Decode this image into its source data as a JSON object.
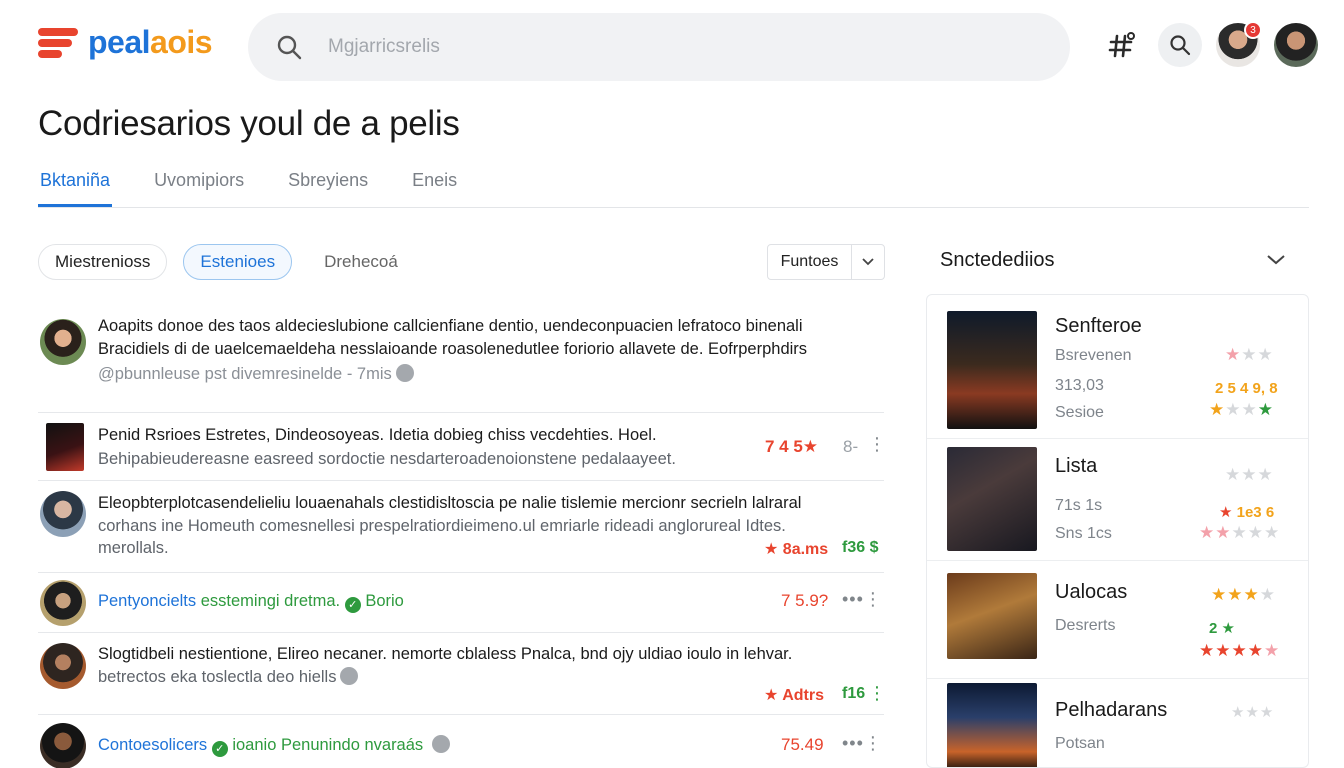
{
  "brand": {
    "name_a": "peal",
    "name_b": "aois",
    "accent": "#1e73d8",
    "orange": "#f39a1c",
    "red": "#e8442e"
  },
  "search": {
    "placeholder": "Mgjarricsrelis",
    "icon": "search-icon"
  },
  "header_icons": {
    "grid": "hashtag-grid-icon",
    "search": "search-icon",
    "badge": "3"
  },
  "page_title": "Codriesarios youl de a pelis",
  "tabs": [
    {
      "label": "Bktaniña",
      "active": true
    },
    {
      "label": "Uvomipiors",
      "active": false
    },
    {
      "label": "Sbreyiens",
      "active": false
    },
    {
      "label": "Eneis",
      "active": false
    }
  ],
  "filters": [
    {
      "label": "Miestrenioss"
    },
    {
      "label": "Estenioes"
    },
    {
      "label": "Drehecoá"
    }
  ],
  "sort": {
    "label": "Funtoes"
  },
  "feed": [
    {
      "line1": "Aoapits donoe des taos aldecieslubione callcienfiane dentio, uendeconpuacien lefratoco binenali",
      "line2": "Bracidiels di de uaelcemaeldeha nesslaioande roasolenedutlee foriorio allavete de. Eofrperphdirs",
      "line3": "@pbunnleuse pst divemresinelde - 7mis"
    },
    {
      "line1": "Penid Rsrioes Estretes, Dindeosoyeas. Idetia dobieg chiss vecdehties. Hoel.",
      "line2": "Behipabieudereasne easreed sordoctie nesdarteroadenoionstene pedalaayeet.",
      "score": "7 4 5★",
      "side": "8-"
    },
    {
      "line1": "Eleopbterplotcasendelieliu louaenahals clestidisltoscia pe nalie tislemie mercionr secrieln lalraral",
      "line2": "corhans ine Homeuth comesnellesi prespelratiordieimeno.ul emriarle rideadi anglorureal Idtes.",
      "line3": "merollals.",
      "score": "★ 8a.ms",
      "side": "f36 $"
    },
    {
      "text_blue": "Pentyoncielts",
      "text_green": "esstemingi dretma.",
      "tag": "Borio",
      "score": "7 5.9?"
    },
    {
      "line1": "Slogtidbeli nestientione, Elireo necaner. nemorte cblaless Pnalca, bnd ojy uldiao ioulo in lehvar.",
      "line2": "betrectos eka toslectla deo hiells",
      "score": "★ Adtrs",
      "side": "f16"
    },
    {
      "text_blue": "Contoesolicers",
      "text_green": "ioanio",
      "text_red": "Penunindo nvaraás",
      "score": "75.49"
    }
  ],
  "panel": {
    "title": "Snctedediios",
    "items": [
      {
        "name": "Senfteroe",
        "l2": "Bsrevenen",
        "l3": "313,03",
        "l4": "Sesioe",
        "score": "2 5 4 9, 8"
      },
      {
        "name": "Lista",
        "l2": "71s 1s",
        "l3": "Sns 1cs",
        "score": "1e3 6"
      },
      {
        "name": "Ualocas",
        "l2": "Desrerts",
        "score": "2"
      },
      {
        "name": "Pelhadarans",
        "l2": "Potsan"
      }
    ]
  }
}
